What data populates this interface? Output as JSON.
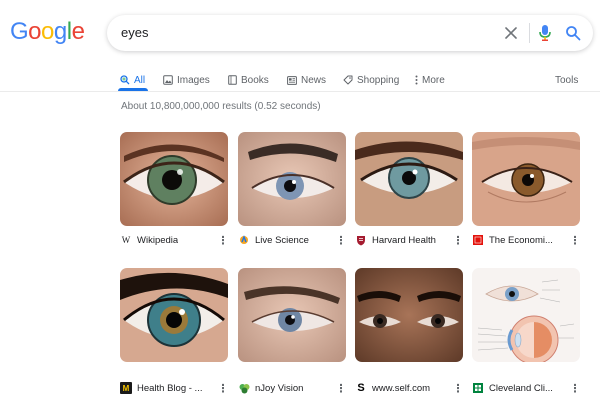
{
  "logo": {
    "letters": [
      "G",
      "o",
      "o",
      "g",
      "l",
      "e"
    ],
    "colors": [
      "#4285f4",
      "#ea4335",
      "#fbbc05",
      "#4285f4",
      "#34a853",
      "#ea4335"
    ]
  },
  "search": {
    "query": "eyes",
    "clear_icon": "close-icon",
    "voice_icon": "mic-icon",
    "search_icon": "search-icon"
  },
  "tabs": [
    {
      "label": "All",
      "icon": "search-icon",
      "active": true
    },
    {
      "label": "Images",
      "icon": "image-icon"
    },
    {
      "label": "Books",
      "icon": "book-icon"
    },
    {
      "label": "News",
      "icon": "news-icon"
    },
    {
      "label": "Shopping",
      "icon": "tag-icon"
    },
    {
      "label": "More",
      "icon": "more-vert-icon"
    }
  ],
  "tools_label": "Tools",
  "result_stats": "About 10,800,000,000 results (0.52 seconds)",
  "results": [
    {
      "site": "Wikipedia",
      "favicon": "W",
      "iris": "#5f8060"
    },
    {
      "site": "Live Science",
      "favicon": "live-science-icon",
      "iris": "#7e95b4"
    },
    {
      "site": "Harvard Health",
      "favicon": "harvard-shield-icon",
      "iris": "#6f9aa0"
    },
    {
      "site": "The Economi...",
      "favicon": "economist-icon",
      "iris": "#8a5a2c"
    },
    {
      "site": "Health Blog - ...",
      "favicon": "M",
      "iris": "#3f7f8a"
    },
    {
      "site": "nJoy Vision",
      "favicon": "njoy-icon",
      "iris": "#6f86a4"
    },
    {
      "site": "www.self.com",
      "favicon": "S",
      "iris": "#3a2a22"
    },
    {
      "site": "Cleveland Cli...",
      "favicon": "cleveland-clinic-icon",
      "iris": "#7aa0c8"
    }
  ],
  "accent": "#1a73e8"
}
